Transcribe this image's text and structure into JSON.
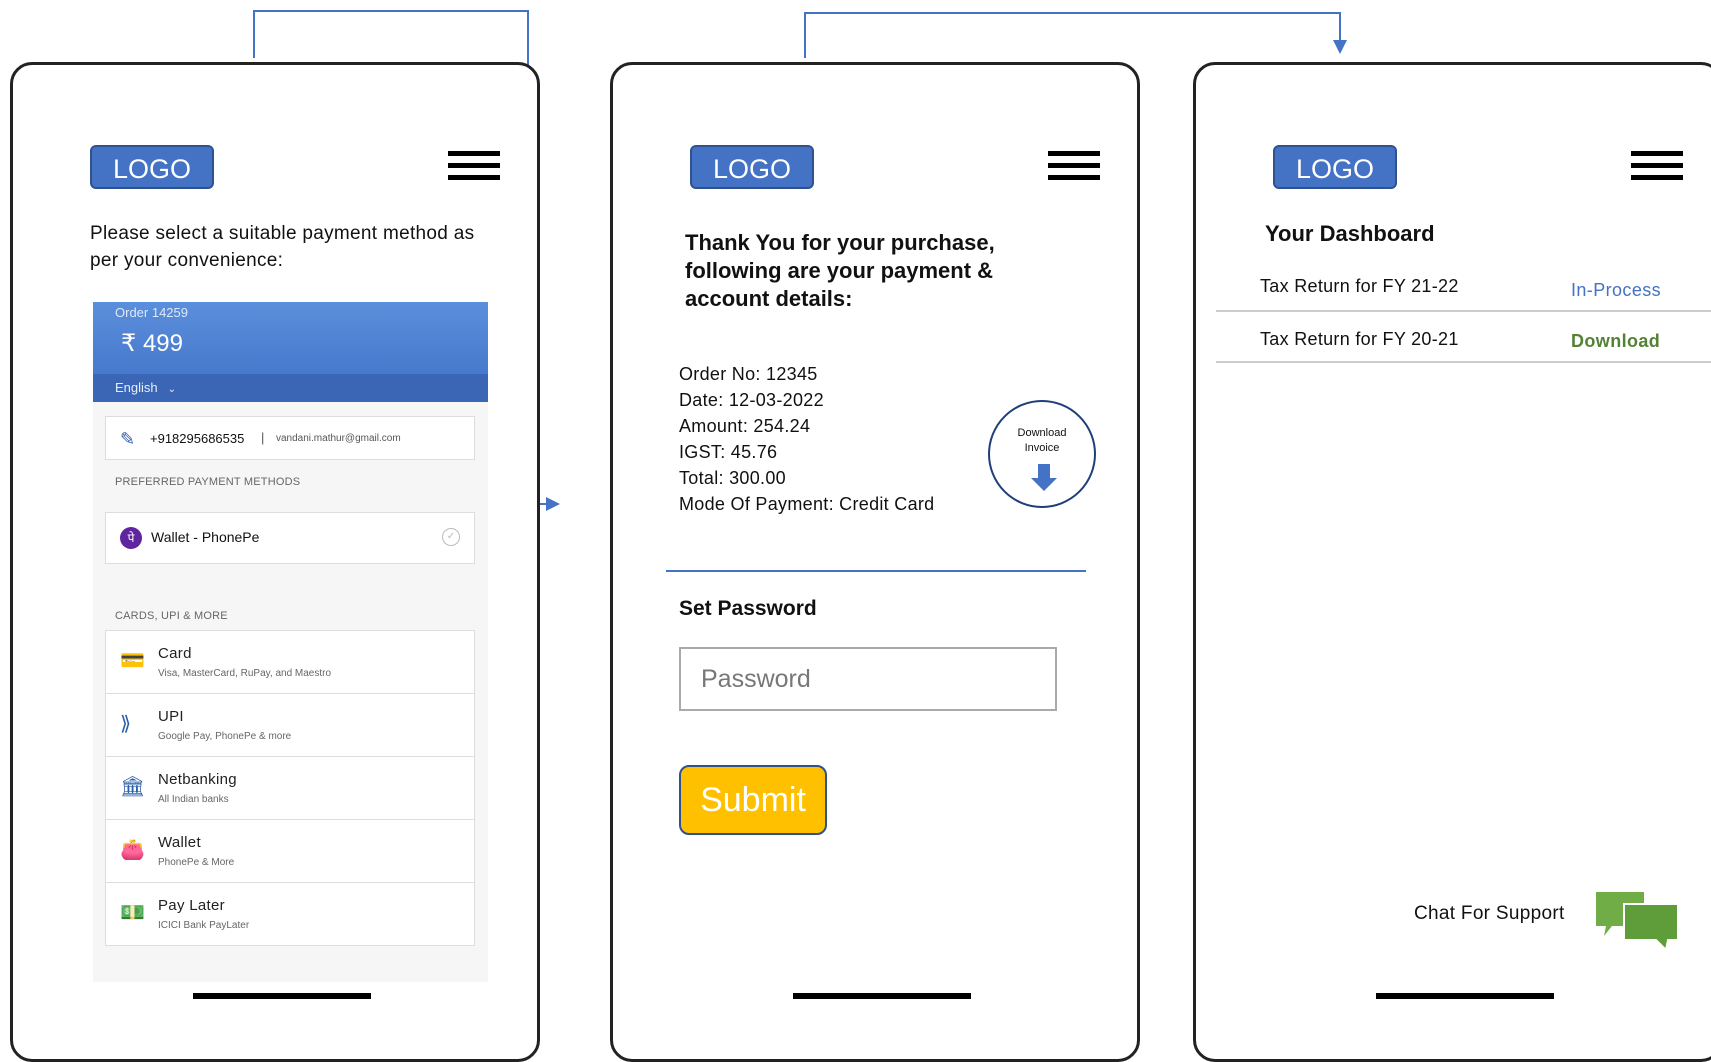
{
  "brand": {
    "logo_text": "LOGO",
    "accent": "#4472c4",
    "submit_color": "#ffc000"
  },
  "screen1": {
    "instruction": "Please select a suitable payment method as per your convenience:",
    "order": {
      "label": "Order 14259",
      "amount": "₹ 499",
      "language": "English"
    },
    "contact": {
      "phone": "+918295686535",
      "separator": "|",
      "email": "vandani.mathur@gmail.com"
    },
    "preferred_title": "PREFERRED PAYMENT METHODS",
    "preferred_method": "Wallet - PhonePe",
    "more_title": "CARDS, UPI & MORE",
    "methods": [
      {
        "name": "Card",
        "sub": "Visa, MasterCard, RuPay, and Maestro",
        "icon": "card-icon"
      },
      {
        "name": "UPI",
        "sub": "Google Pay, PhonePe & more",
        "icon": "upi-icon"
      },
      {
        "name": "Netbanking",
        "sub": "All Indian banks",
        "icon": "bank-icon"
      },
      {
        "name": "Wallet",
        "sub": "PhonePe & More",
        "icon": "wallet-icon"
      },
      {
        "name": "Pay Later",
        "sub": "ICICI Bank PayLater",
        "icon": "paylater-icon"
      }
    ]
  },
  "screen2": {
    "thanks": "Thank You for your purchase, following are your payment & account details:",
    "details": {
      "order_no": "Order No: 12345",
      "date": "Date: 12-03-2022",
      "amount": "Amount: 254.24",
      "igst": "IGST: 45.76",
      "total": "Total: 300.00",
      "mode": "Mode Of Payment: Credit Card"
    },
    "download_line1": "Download",
    "download_line2": "Invoice",
    "set_password_title": "Set Password",
    "password_placeholder": "Password",
    "submit_label": "Submit"
  },
  "screen3": {
    "title": "Your Dashboard",
    "rows": [
      {
        "label": "Tax Return for FY 21-22",
        "status": "In-Process",
        "status_color": "#4472c4"
      },
      {
        "label": "Tax Return for FY 20-21",
        "status": "Download",
        "status_color": "#548235"
      }
    ],
    "chat_label": "Chat For Support"
  }
}
